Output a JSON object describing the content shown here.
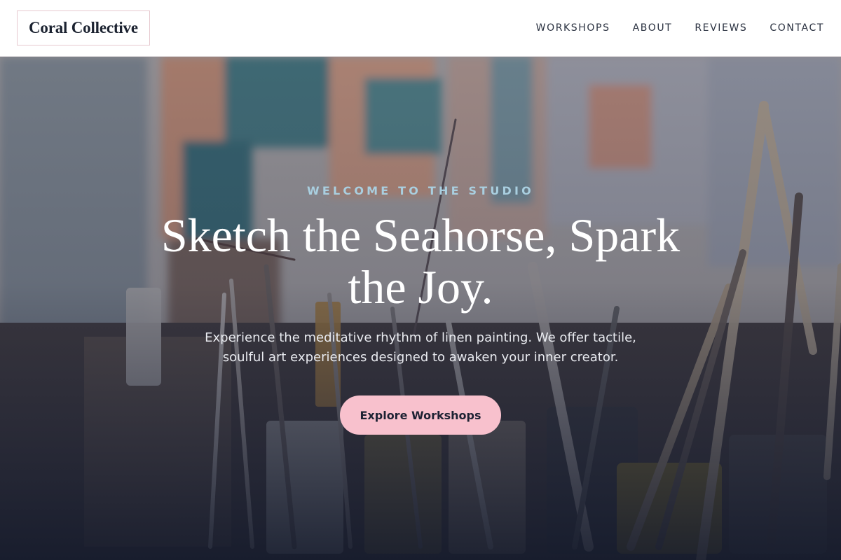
{
  "brand": {
    "name": "Coral Collective"
  },
  "nav": {
    "items": [
      {
        "label": "WORKSHOPS"
      },
      {
        "label": "ABOUT"
      },
      {
        "label": "REVIEWS"
      },
      {
        "label": "CONTACT"
      }
    ]
  },
  "hero": {
    "eyebrow": "WELCOME TO THE STUDIO",
    "headline": "Sketch the Seahorse, Spark the Joy.",
    "lede": "Experience the meditative rhythm of linen painting. We offer tactile, soulful art experiences designed to awaken your inner creator.",
    "cta_label": "Explore Workshops"
  },
  "colors": {
    "accent": "#f8c1cd",
    "eyebrow": "#a9cfe0",
    "overlay": "#1a1f33"
  }
}
